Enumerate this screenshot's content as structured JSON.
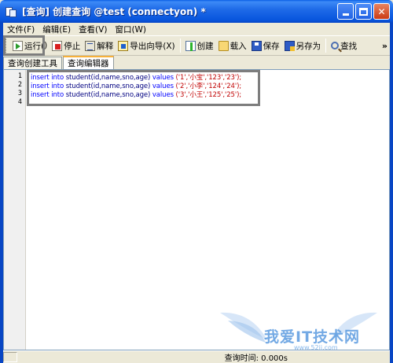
{
  "window": {
    "title": "[查询] 创建查询 @test (connectyon) *",
    "minimize_symbol": "",
    "maximize_symbol": "",
    "close_symbol": "✕"
  },
  "menu": {
    "items": [
      "文件(F)",
      "编辑(E)",
      "查看(V)",
      "窗口(W)"
    ]
  },
  "toolbar": {
    "run": "运行(",
    "run_suffix": ")",
    "stop": "停止",
    "explain": "解释",
    "export": "导出向导(X)",
    "create": "创建",
    "load": "载入",
    "save": "保存",
    "saveas": "另存为",
    "find": "查找",
    "overflow": "»",
    "icons": [
      "run-icon",
      "stop-icon",
      "explain-icon",
      "export-wizard-icon",
      "create-icon",
      "load-icon",
      "save-icon",
      "save-as-icon",
      "find-icon"
    ]
  },
  "tabs": [
    {
      "label": "查询创建工具",
      "active": false
    },
    {
      "label": "查询编辑器",
      "active": true
    }
  ],
  "editor": {
    "lines": [
      {
        "no": "1",
        "kw1": "insert into",
        "tbl": " student(id,name,sno,age) ",
        "kw2": "values",
        "vals": " ('1','小宝','123','23');"
      },
      {
        "no": "2",
        "kw1": "insert into",
        "tbl": " student(id,name,sno,age) ",
        "kw2": "values",
        "vals": " ('2','小李','124','24');"
      },
      {
        "no": "3",
        "kw1": "insert into",
        "tbl": " student(id,name,sno,age) ",
        "kw2": "values",
        "vals": " ('3','小王','125','25');"
      },
      {
        "no": "4",
        "kw1": "",
        "tbl": "",
        "kw2": "",
        "vals": ""
      }
    ],
    "colors": {
      "keyword": "#0000ff",
      "identifier": "#000080",
      "string": "#c00000"
    }
  },
  "watermark": {
    "text": "我爱IT技术网",
    "sub": "www.52ij.com"
  },
  "status": {
    "query_time": "查询时间: 0.000s"
  }
}
